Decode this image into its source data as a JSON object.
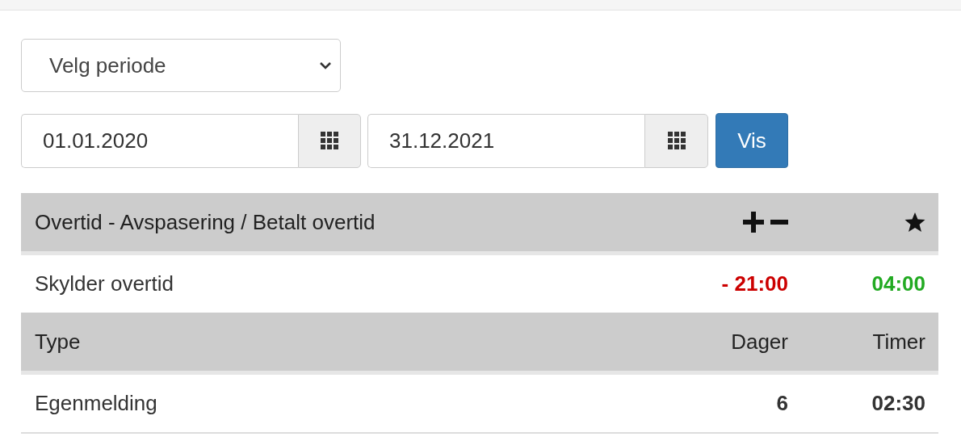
{
  "period_select": {
    "value": "Velg periode"
  },
  "date_from": {
    "value": "01.01.2020"
  },
  "date_to": {
    "value": "31.12.2021"
  },
  "show_button": {
    "label": "Vis"
  },
  "summary_table": {
    "title": "Overtid - Avspasering / Betalt overtid",
    "rows": [
      {
        "label": "Skylder overtid",
        "cells": [
          {
            "text": "- 21:00",
            "kind": "negative"
          },
          {
            "text": "04:00",
            "kind": "positive"
          }
        ]
      }
    ]
  },
  "detail_table": {
    "columns": [
      "Type",
      "Dager",
      "Timer"
    ],
    "rows": [
      {
        "cells": [
          "Egenmelding",
          "6",
          "02:30"
        ]
      }
    ]
  }
}
